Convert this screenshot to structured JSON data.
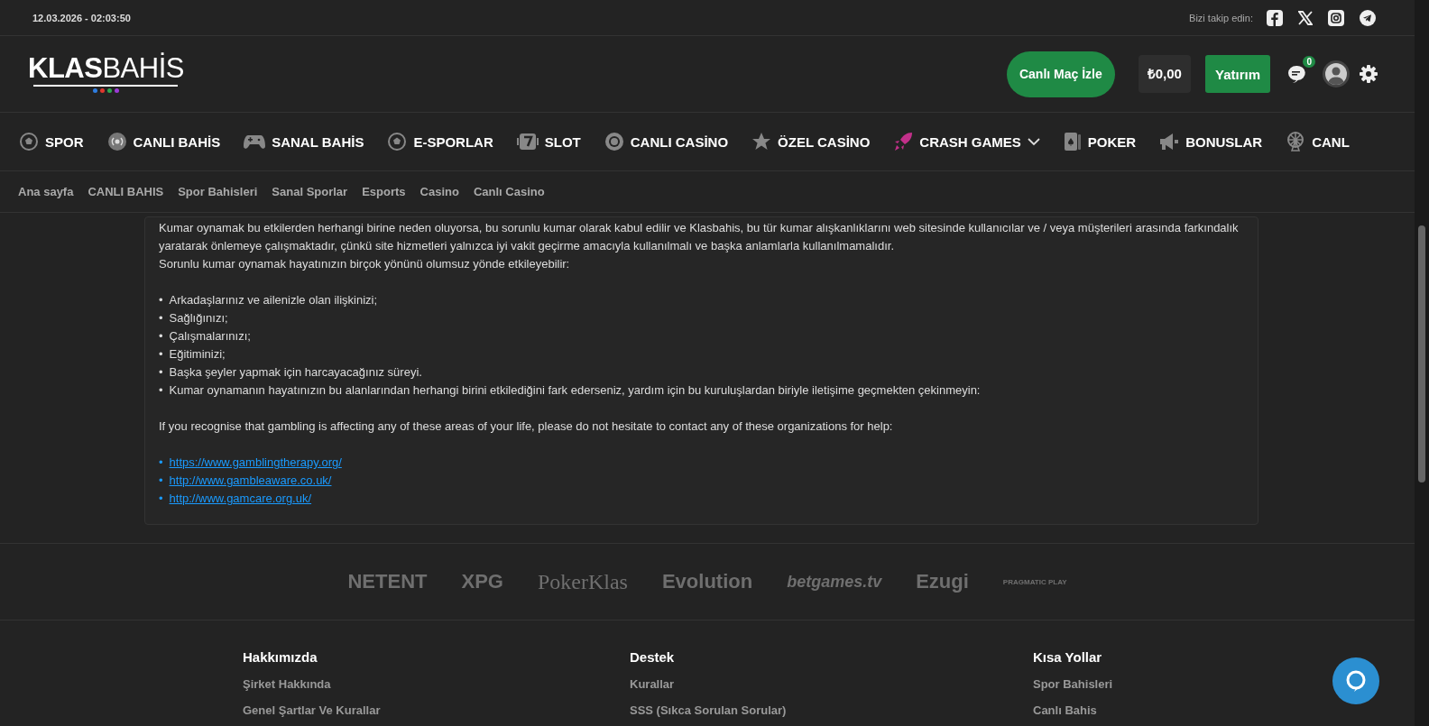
{
  "top_bar": {
    "datetime": "12.03.2026 - 02:03:50",
    "follow_label": "Bizi takip edin:"
  },
  "header": {
    "logo": "**KLAS**BAHİS",
    "watch_button": "Canlı Maç İzle",
    "balance": "₺0,00",
    "deposit_button": "Yatırım",
    "messages_badge": "0"
  },
  "main_nav": [
    {
      "label": "SPOR",
      "kind": "ball"
    },
    {
      "label": "CANLI BAHİS",
      "kind": "live"
    },
    {
      "label": "SANAL BAHİS",
      "kind": "gamepad"
    },
    {
      "label": "E-SPORLAR",
      "kind": "ball"
    },
    {
      "label": "SLOT",
      "kind": "slot"
    },
    {
      "label": "CANLI CASİNO",
      "kind": "chip"
    },
    {
      "label": "ÖZEL CASİNO",
      "kind": "star"
    },
    {
      "label": "CRASH GAMES",
      "kind": "rocket",
      "dropdown": true
    },
    {
      "label": "POKER",
      "kind": "card"
    },
    {
      "label": "BONUSLAR",
      "kind": "megaphone"
    },
    {
      "label": "CANL",
      "kind": "wheel"
    }
  ],
  "breadcrumb_nav": [
    "Ana sayfa",
    "CANLI BAHIS",
    "Spor Bahisleri",
    "Sanal Sporlar",
    "Esports",
    "Casino",
    "Canlı Casino"
  ],
  "content": {
    "bullet": "•",
    "paragraphs": [
      "Kumar oynamak bu etkilerden herhangi birine neden oluyorsa, bu sorunlu kumar olarak kabul edilir ve Klasbahis, bu tür kumar alışkanlıklarını web sitesinde kullanıcılar ve / veya müşterileri arasında farkındalık yaratarak önlemeye çalışmaktadır, çünkü site hizmetleri yalnızca iyi vakit geçirme amacıyla kullanılmalı ve başka anlamlarla kullanılmamalıdır.",
      "Sorunlu kumar oynamak hayatınızın birçok yönünü olumsuz yönde etkileyebilir:"
    ],
    "effects": [
      "Arkadaşlarınız ve ailenizle olan ilişkinizi;",
      "Sağlığınızı;",
      "Çalışmalarınızı;",
      "Eğitiminizi;",
      "Başka şeyler yapmak için harcayacağınız süreyi.",
      "Kumar oynamanın hayatınızın bu alanlarından herhangi birini etkilediğini fark ederseniz, yardım için bu kuruluşlardan biriyle iletişime geçmekten çekinmeyin:"
    ],
    "english_note": "If you recognise that gambling is affecting any of these areas of your life, please do not hesitate to contact any of these organizations for help:",
    "links": [
      "https://www.gamblingtherapy.org/",
      "http://www.gambleaware.co.uk/",
      "http://www.gamcare.org.uk/"
    ]
  },
  "providers": [
    {
      "name": "NETENT",
      "kind": "sans"
    },
    {
      "name": "XPG",
      "kind": "sans"
    },
    {
      "name": "PokerKlas",
      "kind": "serif"
    },
    {
      "name": "Evolution",
      "kind": "sans"
    },
    {
      "name": "betgames.tv",
      "kind": "italic"
    },
    {
      "name": "Ezugi",
      "kind": "sans"
    },
    {
      "name": "PRAGMATIC PLAY",
      "kind": "small"
    }
  ],
  "footer_columns": [
    {
      "title": "Hakkımızda",
      "links": [
        "Şirket Hakkında",
        "Genel Şartlar Ve Kurallar"
      ]
    },
    {
      "title": "Destek",
      "links": [
        "Kurallar",
        "SSS (Sıkca Sorulan Sorular)"
      ]
    },
    {
      "title": "Kısa Yollar",
      "links": [
        "Spor Bahisleri",
        "Canlı Bahis"
      ]
    }
  ]
}
